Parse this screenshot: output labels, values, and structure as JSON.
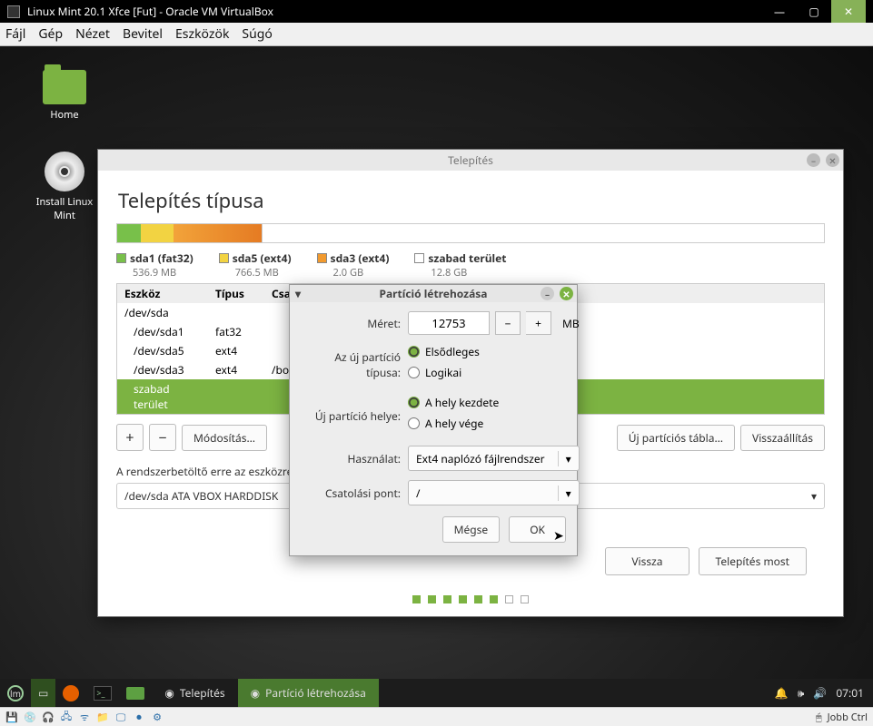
{
  "vb": {
    "title": "Linux Mint 20.1 Xfce [Fut] - Oracle VM VirtualBox",
    "menu": [
      "Fájl",
      "Gép",
      "Nézet",
      "Bevitel",
      "Eszközök",
      "Súgó"
    ],
    "status_right": "Jobb Ctrl"
  },
  "desktop": {
    "icons": [
      {
        "label": "Home"
      },
      {
        "label": "Install Linux Mint"
      }
    ]
  },
  "installer": {
    "title": "Telepítés",
    "heading": "Telepítés típusa",
    "legend": [
      {
        "name": "sda1 (fat32)",
        "size": "536.9 MB",
        "color": "#78c04a"
      },
      {
        "name": "sda5 (ext4)",
        "size": "766.5 MB",
        "color": "#f2d342"
      },
      {
        "name": "sda3 (ext4)",
        "size": "2.0 GB",
        "color": "#f29a2e"
      },
      {
        "name": "szabad terület",
        "size": "12.8 GB",
        "color": "#ffffff"
      }
    ],
    "table": {
      "headers": [
        "Eszköz",
        "Típus",
        "Csatolás"
      ],
      "rows": [
        {
          "dev": "/dev/sda",
          "type": "",
          "mount": ""
        },
        {
          "dev": "/dev/sda1",
          "type": "fat32",
          "mount": ""
        },
        {
          "dev": "/dev/sda5",
          "type": "ext4",
          "mount": ""
        },
        {
          "dev": "/dev/sda3",
          "type": "ext4",
          "mount": "/boot"
        },
        {
          "dev": "szabad terület",
          "type": "",
          "mount": "",
          "selected": true
        }
      ]
    },
    "buttons": {
      "change": "Módosítás…",
      "new_table": "Új partíciós tábla…",
      "revert": "Visszaállítás",
      "back": "Vissza",
      "install": "Telepítés most"
    },
    "bootloader": {
      "label": "A rendszerbetöltő erre az eszközre",
      "value": "/dev/sda   ATA VBOX HARDDISK"
    }
  },
  "dialog": {
    "title": "Partíció létrehozása",
    "size_label": "Méret:",
    "size_value": "12753",
    "size_unit": "MB",
    "type_label": "Az új partíció típusa:",
    "type_primary": "Elsődleges",
    "type_logical": "Logikai",
    "loc_label": "Új partíció helye:",
    "loc_begin": "A hely kezdete",
    "loc_end": "A hely vége",
    "use_label": "Használat:",
    "use_value": "Ext4 naplózó fájlrendszer",
    "mount_label": "Csatolási pont:",
    "mount_value": "/",
    "cancel": "Mégse",
    "ok": "OK"
  },
  "taskbar": {
    "items": [
      {
        "label": "Telepítés",
        "active": false
      },
      {
        "label": "Partíció létrehozása",
        "active": true
      }
    ],
    "clock": "07:01"
  }
}
